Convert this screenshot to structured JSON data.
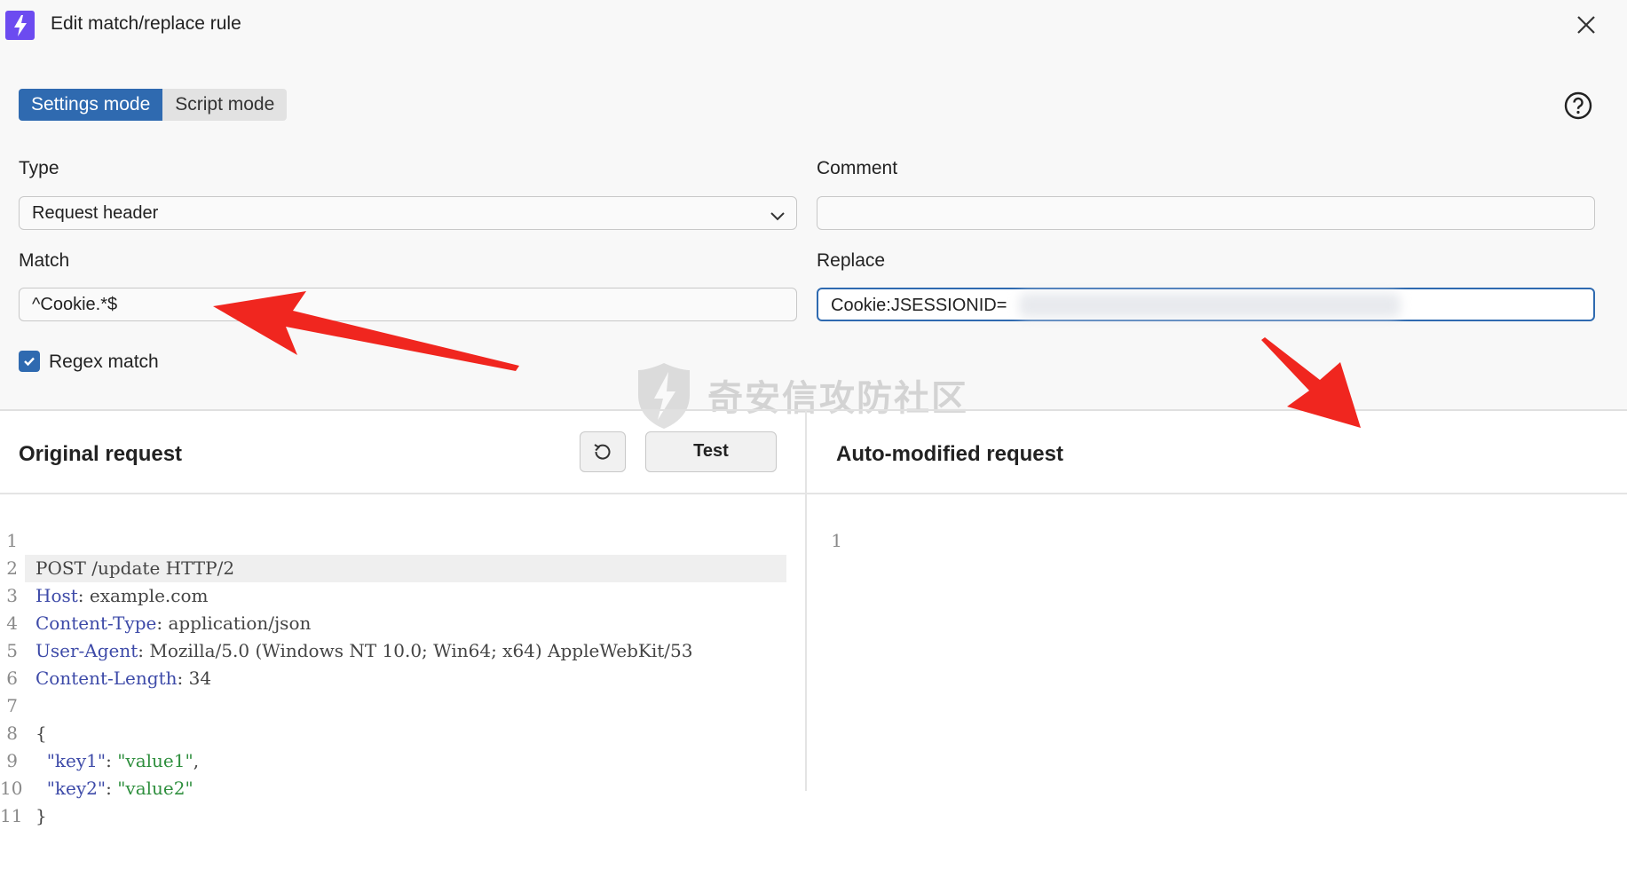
{
  "window": {
    "title": "Edit match/replace rule",
    "icon": "lightning-icon",
    "close_icon": "close-icon",
    "accent_color": "#2f6ab0",
    "brand_color": "#6c4bf0"
  },
  "modes": {
    "settings_label": "Settings mode",
    "script_label": "Script mode",
    "selected": "Settings mode"
  },
  "help_icon": "help-icon",
  "form": {
    "type_label": "Type",
    "type_value": "Request header",
    "comment_label": "Comment",
    "comment_value": "",
    "match_label": "Match",
    "match_value": "^Cookie.*$",
    "replace_label": "Replace",
    "replace_value": "Cookie:JSESSIONID=",
    "regex_label": "Regex match",
    "regex_checked": true
  },
  "watermark": {
    "text": "奇安信攻防社区"
  },
  "original": {
    "title": "Original request",
    "reset_icon": "reset-icon",
    "test_label": "Test",
    "lines": [
      {
        "n": "1",
        "text": "POST /update HTTP/2"
      },
      {
        "n": "2",
        "key": "Host",
        "rest": ": example.com"
      },
      {
        "n": "3",
        "key": "Content-Type",
        "rest": ": application/json"
      },
      {
        "n": "4",
        "key": "User-Agent",
        "rest": ": Mozilla/5.0 (Windows NT 10.0; Win64; x64) AppleWebKit/53"
      },
      {
        "n": "5",
        "key": "Content-Length",
        "rest": ": 34"
      },
      {
        "n": "6",
        "text": ""
      },
      {
        "n": "7",
        "text": "{"
      },
      {
        "n": "8",
        "jkey": "\"key1\"",
        "sep": ": ",
        "jval": "\"value1\"",
        "end": ","
      },
      {
        "n": "9",
        "jkey": "\"key2\"",
        "sep": ": ",
        "jval": "\"value2\"",
        "end": ""
      },
      {
        "n": "10",
        "text": "}"
      },
      {
        "n": "11",
        "text": ""
      }
    ]
  },
  "modified": {
    "title": "Auto-modified request",
    "lines": [
      {
        "n": "1",
        "text": ""
      }
    ]
  }
}
